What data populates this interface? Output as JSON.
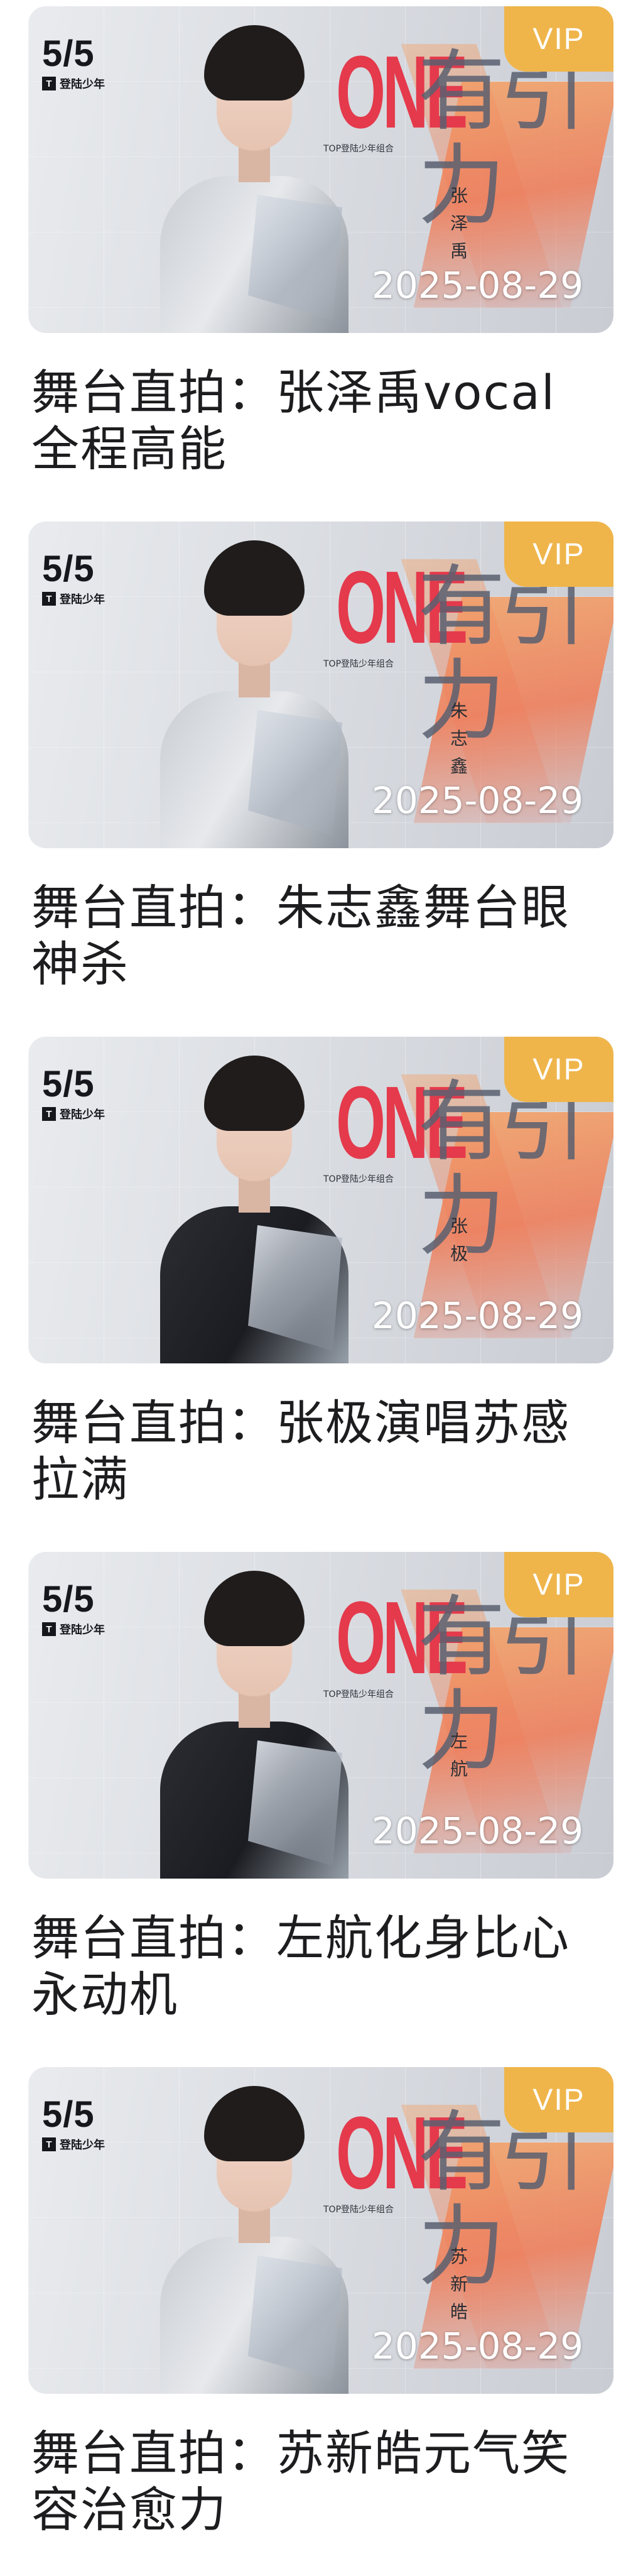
{
  "feed": {
    "items": [
      {
        "badge": "VIP",
        "date": "2025-08-29",
        "logo_date": "5/5",
        "logo_brand": "登陆少年",
        "show_en": "ONE",
        "show_cn": "有引力",
        "tag": "TOP登陆少年组合",
        "member_vertical": "张泽禹",
        "title": "舞台直拍：张泽禹vocal全程高能",
        "outfit": "light"
      },
      {
        "badge": "VIP",
        "date": "2025-08-29",
        "logo_date": "5/5",
        "logo_brand": "登陆少年",
        "show_en": "ONE",
        "show_cn": "有引力",
        "tag": "TOP登陆少年组合",
        "member_vertical": "朱志鑫",
        "title": "舞台直拍：朱志鑫舞台眼神杀",
        "outfit": "light"
      },
      {
        "badge": "VIP",
        "date": "2025-08-29",
        "logo_date": "5/5",
        "logo_brand": "登陆少年",
        "show_en": "ONE",
        "show_cn": "有引力",
        "tag": "TOP登陆少年组合",
        "member_vertical": "张极",
        "title": "舞台直拍：张极演唱苏感拉满",
        "outfit": "dark"
      },
      {
        "badge": "VIP",
        "date": "2025-08-29",
        "logo_date": "5/5",
        "logo_brand": "登陆少年",
        "show_en": "ONE",
        "show_cn": "有引力",
        "tag": "TOP登陆少年组合",
        "member_vertical": "左航",
        "title": "舞台直拍：左航化身比心永动机",
        "outfit": "dark"
      },
      {
        "badge": "VIP",
        "date": "2025-08-29",
        "logo_date": "5/5",
        "logo_brand": "登陆少年",
        "show_en": "ONE",
        "show_cn": "有引力",
        "tag": "TOP登陆少年组合",
        "member_vertical": "苏新皓",
        "title": "舞台直拍：苏新皓元气笑容治愈力",
        "outfit": "light"
      }
    ]
  },
  "colors": {
    "vip_badge": "#efb54b",
    "show_red": "#e43a4c",
    "text": "#1d1d1f"
  }
}
